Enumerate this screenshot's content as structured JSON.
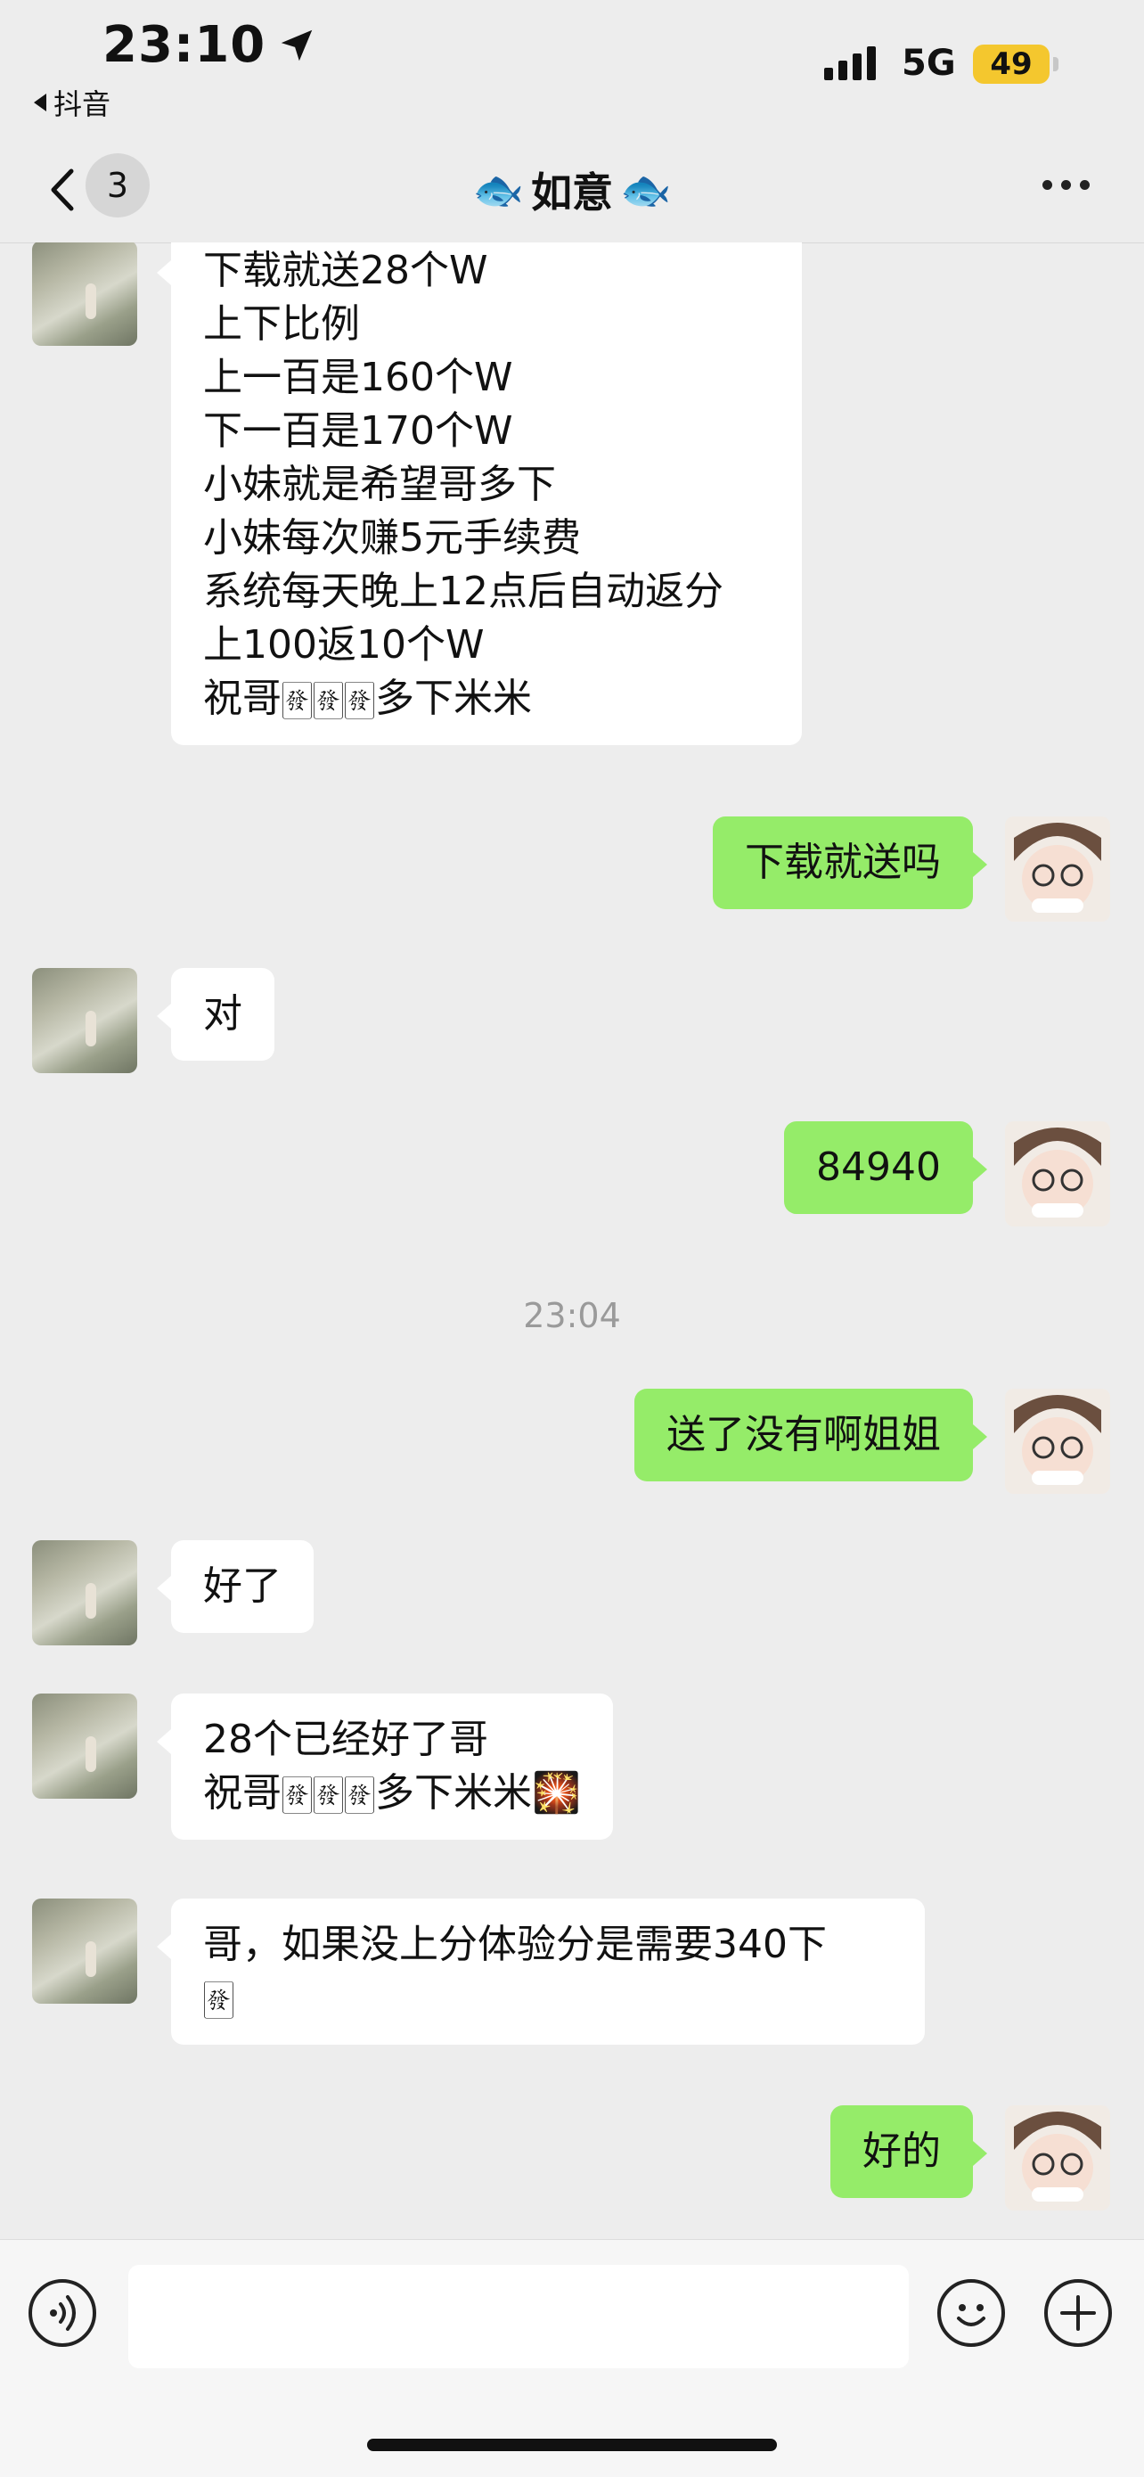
{
  "status": {
    "time": "23:10",
    "back_app": "抖音",
    "network": "5G",
    "battery": "49"
  },
  "nav": {
    "unread_count": "3",
    "title": "如意",
    "title_emoji_left": "🐟",
    "title_emoji_right": "🐟"
  },
  "messages": [
    {
      "side": "left",
      "text": "下载就送28个W\n上下比例\n上一百是160个W\n下一百是170个W\n小妹就是希望哥多下\n小妹每次赚5元手续费\n系统每天晚上12点后自动返分\n上100返10个W\n祝哥🀅🀅🀅多下米米"
    },
    {
      "side": "right",
      "text": "下载就送吗"
    },
    {
      "side": "left",
      "text": "对"
    },
    {
      "side": "right",
      "text": "84940"
    },
    {
      "side": "right",
      "text": "送了没有啊姐姐"
    },
    {
      "side": "left",
      "text": "好了"
    },
    {
      "side": "left",
      "text": "28个已经好了哥\n祝哥🀅🀅🀅多下米米🎇"
    },
    {
      "side": "left",
      "text": "哥，如果没上分体验分是需要340下\n🀅"
    },
    {
      "side": "right",
      "text": "好的"
    }
  ],
  "timestamp": "23:04",
  "input": {
    "placeholder": ""
  }
}
